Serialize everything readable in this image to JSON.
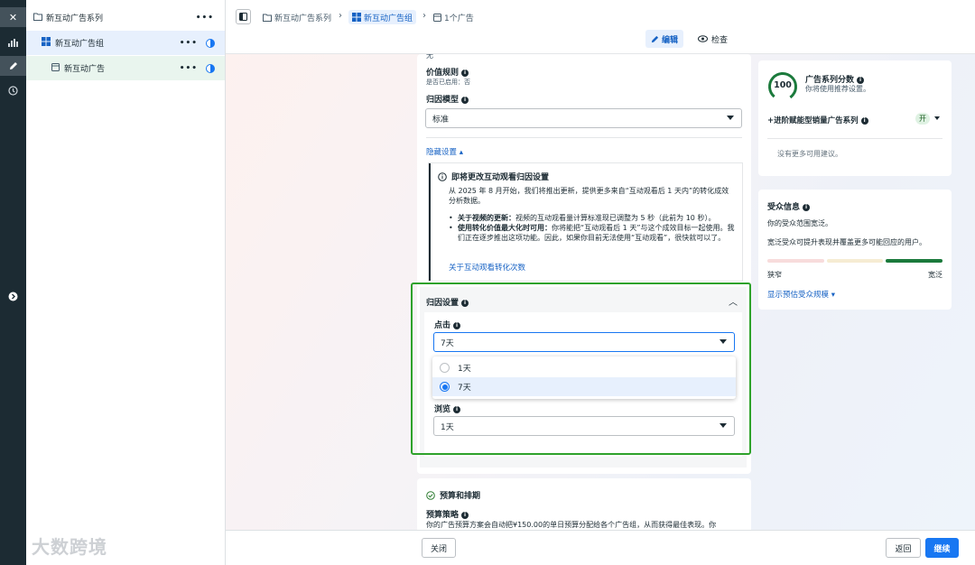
{
  "rail": {
    "close_icon": "✕",
    "chart_icon": "chart-icon",
    "edit_icon": "pencil-icon",
    "history_icon": "clock-icon"
  },
  "tree": {
    "campaign": "新互动广告系列",
    "adset": "新互动广告组",
    "ad": "新互动广告",
    "more": "•••"
  },
  "header": {
    "crumb_campaign": "新互动广告系列",
    "crumb_adset": "新互动广告组",
    "crumb_ad": "1个广告",
    "edit_label": "编辑",
    "review_label": "检查"
  },
  "settings": {
    "truncated_top": "无",
    "value_rule_title": "价值规则",
    "value_rule_sub": "是否已启用：否",
    "attribution_model_title": "归因模型",
    "attribution_model_value": "标准",
    "hide_settings": "隐藏设置",
    "notice_title": "即将更改互动观看归因设置",
    "notice_body": "从 2025 年 8 月开始，我们将推出更新，提供更多来自“互动观看后 1 天内”的转化成效分析数据。",
    "bullet1_bold": "关于视频的更新：",
    "bullet1_text": "视频的互动观看量计算标准现已调整为 5 秒（此前为 10 秒）。",
    "bullet2_bold": "使用转化价值最大化时可用：",
    "bullet2_text": "你将能把“互动观看后 1 天”与这个成效目标一起使用。我们正在逐步推出这项功能。因此，如果你目前无法使用“互动观看”，很快就可以了。",
    "notice_link": "关于互动观看转化次数",
    "attribution_title": "归因设置",
    "click_label": "点击",
    "click_value": "7天",
    "options": [
      "1天",
      "7天"
    ],
    "view_label": "浏览",
    "view_value": "1天"
  },
  "budget": {
    "title": "预算和排期",
    "strategy_title": "预算策略",
    "strategy_text": "你的广告预算方案会自动把¥150.00的单日预算分配给各个广告组，从而获得最佳表现。你"
  },
  "score": {
    "value": "100",
    "title": "广告系列分数",
    "subtitle": "你将使用推荐设置。",
    "advantage_label": "+进阶赋能型销量广告系列",
    "toggle_label": "开",
    "no_suggestions": "没有更多可用建议。"
  },
  "audience": {
    "title": "受众信息",
    "line1": "你的受众范围宽泛。",
    "line2": "宽泛受众可提升表现并覆盖更多可能回应的用户。",
    "narrow": "狭窄",
    "broad": "宽泛",
    "link": "显示预估受众规模"
  },
  "footer": {
    "close": "关闭",
    "back": "返回",
    "continue": "继续"
  },
  "watermark": "大数跨境"
}
